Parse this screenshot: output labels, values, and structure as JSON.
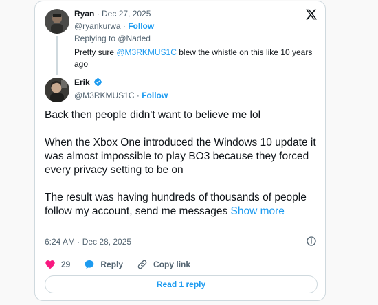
{
  "parent": {
    "name": "Ryan",
    "date": "· Dec 27, 2025",
    "handle": "@ryankurwa ·",
    "follow": "Follow",
    "replying_to": "Replying to @Naded",
    "text_before": "Pretty sure ",
    "mention": "@M3RKMUS1C",
    "text_after": " blew the whistle on this like 10 years ago"
  },
  "tweet": {
    "name": "Erik",
    "handle": "@M3RKMUS1C ·",
    "follow": "Follow",
    "paragraphs": [
      "Back then people didn't want to believe me lol",
      "When the Xbox One introduced the Windows 10 update it was almost impossible to play BO3 because they forced every privacy setting to be on",
      "The result was having hundreds of thousands of people follow my account, send me messages "
    ],
    "show_more": "Show more",
    "timestamp": "6:24 AM · Dec 28, 2025"
  },
  "actions": {
    "likes": "29",
    "reply": "Reply",
    "copy_link": "Copy link"
  },
  "read_reply": "Read 1 reply",
  "colors": {
    "accent": "#1d9bf0",
    "like": "#f91880",
    "muted": "#536471",
    "border": "#cfd9de"
  }
}
